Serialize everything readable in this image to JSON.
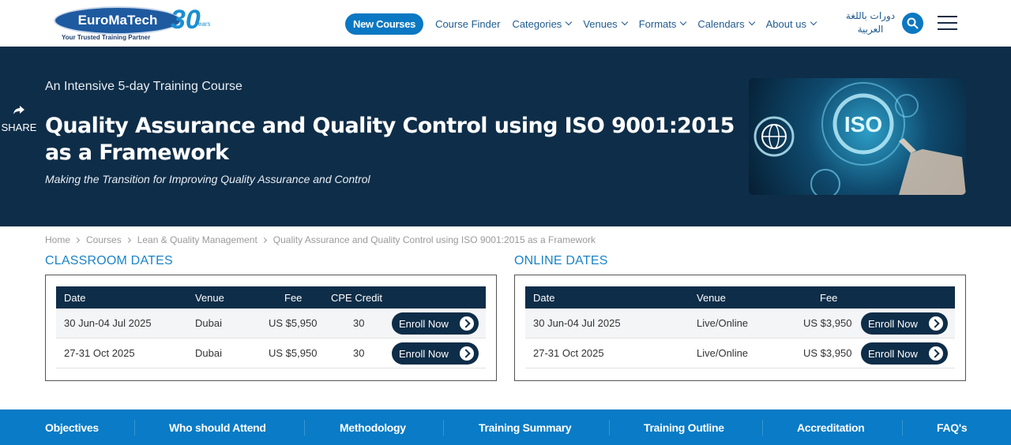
{
  "header": {
    "logo": {
      "name": "EuroMaTech",
      "tagline": "Your Trusted Training Partner",
      "anniversary": "30",
      "years": "Years"
    },
    "nav": {
      "new_courses": "New Courses",
      "items": [
        "Course Finder",
        "Categories",
        "Venues",
        "Formats",
        "Calendars",
        "About us"
      ]
    },
    "arabic_line1": "دورات باللغة",
    "arabic_line2": "العربية"
  },
  "hero": {
    "share": "SHARE",
    "subtitle": "An Intensive 5-day Training Course",
    "title": "Quality Assurance and Quality Control using ISO 9001:2015 as a Framework",
    "tagline": "Making the Transition for Improving Quality Assurance and Control",
    "image_text": "ISO"
  },
  "breadcrumb": [
    "Home",
    "Courses",
    "Lean & Quality Management",
    "Quality Assurance and Quality Control using ISO 9001:2015 as a Framework"
  ],
  "classroom": {
    "title": "CLASSROOM DATES",
    "headers": {
      "date": "Date",
      "venue": "Venue",
      "fee": "Fee",
      "cpe": "CPE Credit"
    },
    "rows": [
      {
        "date": "30 Jun-04 Jul 2025",
        "venue": "Dubai",
        "fee": "US $5,950",
        "cpe": "30",
        "action": "Enroll Now"
      },
      {
        "date": "27-31 Oct 2025",
        "venue": "Dubai",
        "fee": "US $5,950",
        "cpe": "30",
        "action": "Enroll Now"
      }
    ]
  },
  "online": {
    "title": "ONLINE DATES",
    "headers": {
      "date": "Date",
      "venue": "Venue",
      "fee": "Fee"
    },
    "rows": [
      {
        "date": "30 Jun-04 Jul 2025",
        "venue": "Live/Online",
        "fee": "US $3,950",
        "action": "Enroll Now"
      },
      {
        "date": "27-31 Oct 2025",
        "venue": "Live/Online",
        "fee": "US $3,950",
        "action": "Enroll Now"
      }
    ]
  },
  "tabs": [
    "Objectives",
    "Who should Attend",
    "Methodology",
    "Training Summary",
    "Training Outline",
    "Accreditation",
    "FAQ's"
  ]
}
